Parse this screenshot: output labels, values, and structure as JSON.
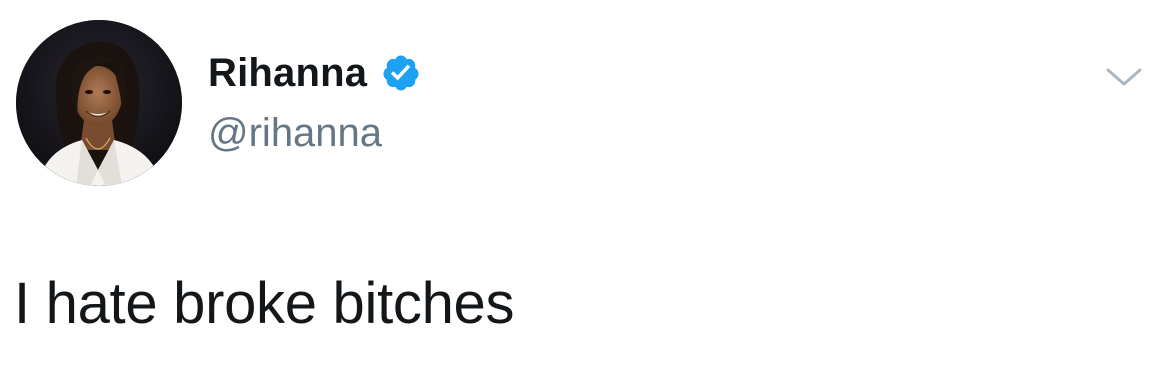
{
  "tweet": {
    "author": {
      "display_name": "Rihanna",
      "handle": "@rihanna",
      "verified": true
    },
    "text": "I hate broke bitches",
    "icons": {
      "verified": "verified-badge-icon",
      "menu": "chevron-down-icon",
      "avatar": "profile-photo"
    },
    "colors": {
      "verified_blue": "#1da1f2",
      "handle_gray": "#657786",
      "text_dark": "#14171a",
      "caret_gray": "#aab8c2"
    }
  }
}
